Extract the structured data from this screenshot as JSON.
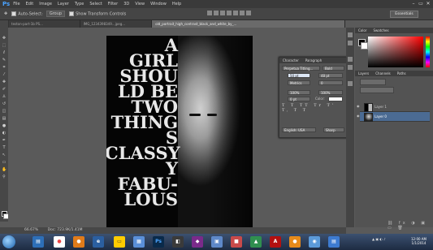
{
  "menubar": {
    "logo": "Ps",
    "items": [
      "File",
      "Edit",
      "Image",
      "Layer",
      "Type",
      "Select",
      "Filter",
      "3D",
      "View",
      "Window",
      "Help"
    ],
    "controls": [
      "–",
      "▭",
      "✕"
    ]
  },
  "options": {
    "auto_select_label": "Auto-Select:",
    "auto_select_value": "Group",
    "transform_label": "Show Transform Controls",
    "workspace": "Essentials"
  },
  "tabs": [
    {
      "label": "teston-part-1b PS..."
    },
    {
      "label": "IMG_1234398349...jpeg..."
    },
    {
      "label": "old_portrait_high_contrast_black_and_white_by_..."
    }
  ],
  "canvas": {
    "words": [
      "A",
      "GIRL",
      "SHOU",
      "LD BE",
      "TWO",
      "THING",
      "S",
      "CLASSY",
      "Y",
      "FABU-",
      "LOUS"
    ]
  },
  "character_panel": {
    "tabs": [
      "Character",
      "Paragraph"
    ],
    "font_family": "Perpetua Titling...",
    "font_style": "Bold",
    "size": "50 pt",
    "leading": "48 pt",
    "kerning": "Metrics",
    "tracking": "0",
    "vscale": "100%",
    "hscale": "100%",
    "baseline": "0 pt",
    "color_label": "Color:",
    "type_styles": "T T TT Tr T' T, T T",
    "language": "English: USA",
    "antialias": "Sharp"
  },
  "panels": {
    "color_tabs": [
      "Color",
      "Swatches"
    ],
    "layer_tabs": [
      "Layers",
      "Channels",
      "Paths"
    ],
    "layers": [
      {
        "name": "Layer 1"
      },
      {
        "name": "Layer 0"
      }
    ]
  },
  "status": {
    "zoom": "66.67%",
    "doc": "Doc: 723.9K/1.41M"
  },
  "taskbar": {
    "time": "12:00 AM",
    "date": "1/1/2014"
  },
  "colors": {
    "accent": "#4aa3ff",
    "selected_layer": "#4b6b93"
  }
}
